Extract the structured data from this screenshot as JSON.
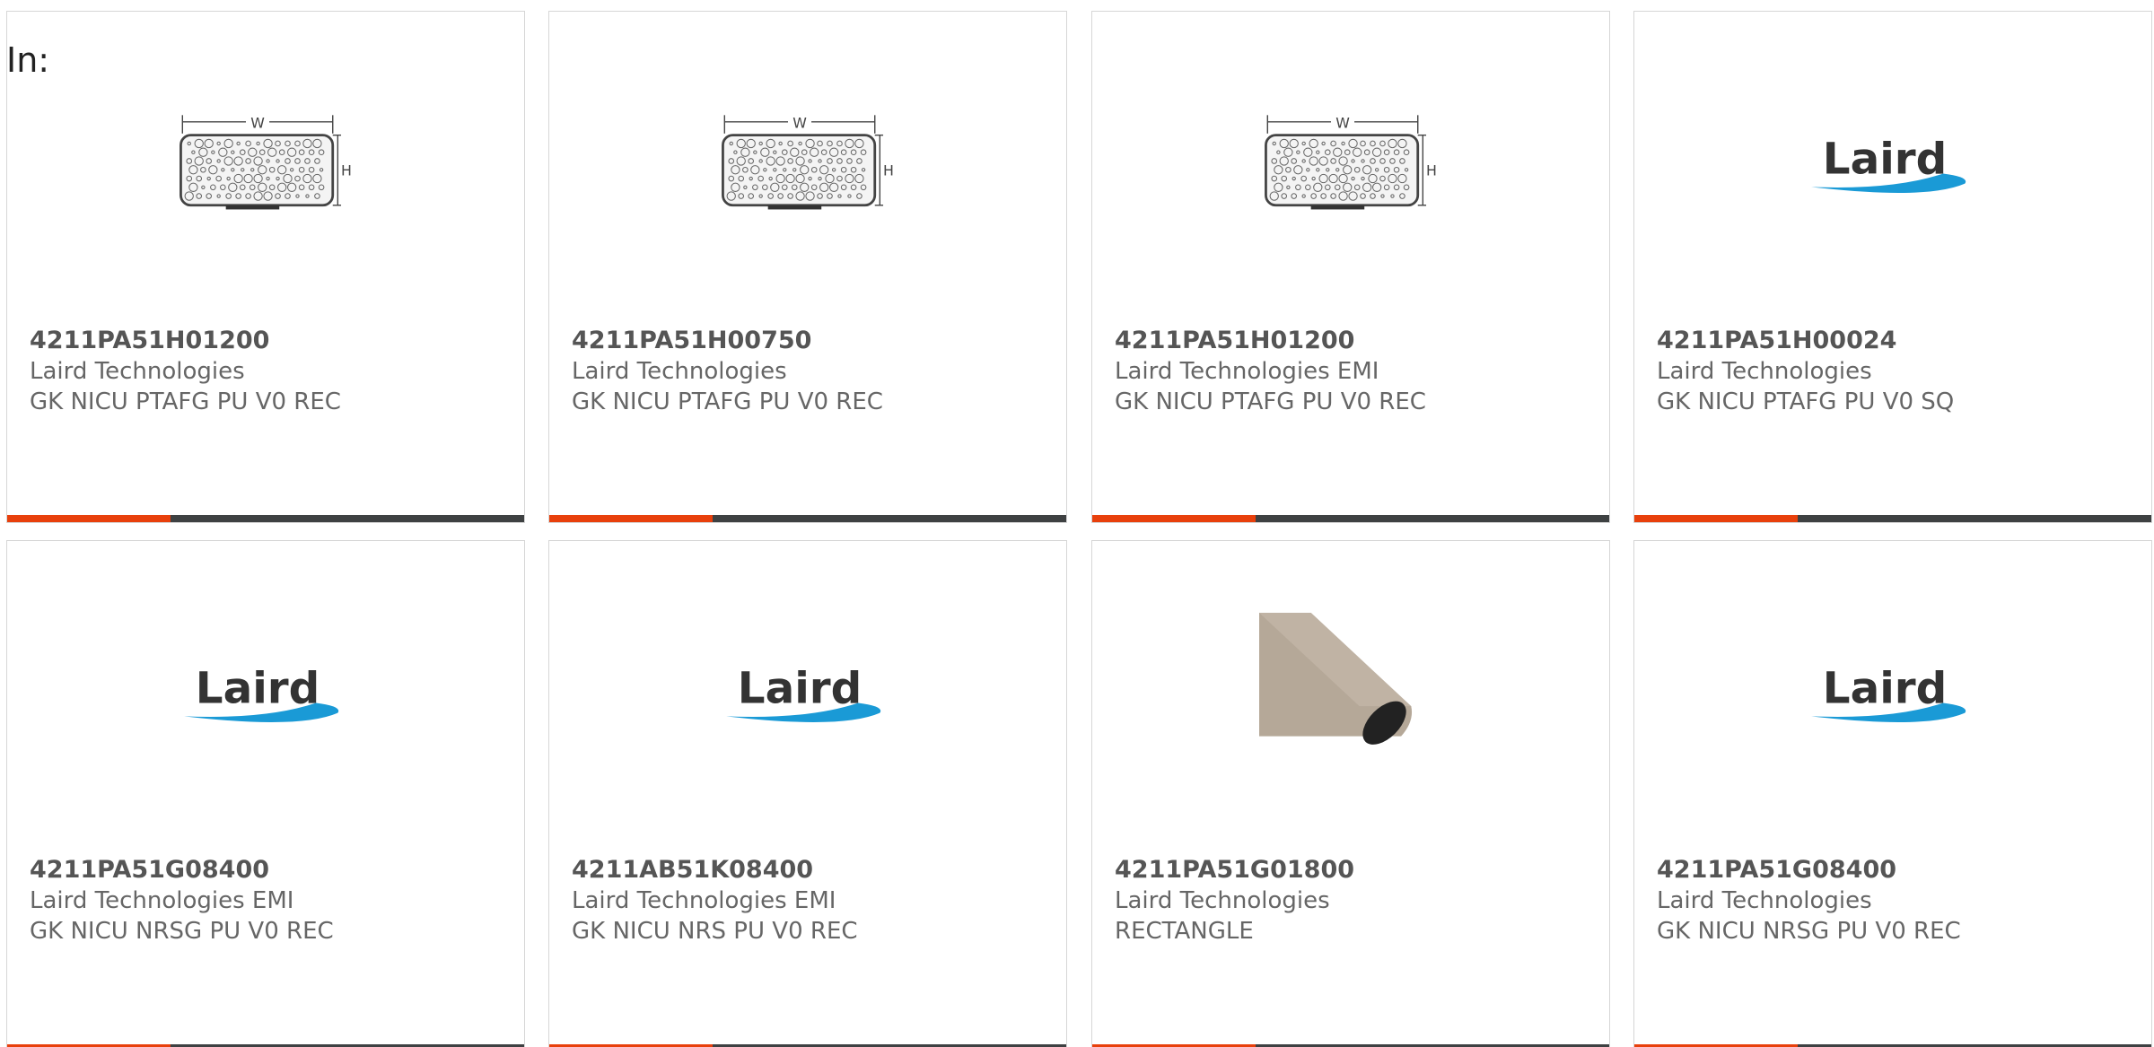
{
  "header": {
    "in_label": "In:"
  },
  "colors": {
    "accent_bar": "#e8400c",
    "dark_bar": "#3e4142",
    "laird_blue": "#1a9ad6",
    "text_bold": "#555555",
    "text_regular": "#666666"
  },
  "products": [
    {
      "part_number": "4211PA51H01200",
      "manufacturer": "Laird Technologies",
      "description": "GK NICU PTAFG PU V0 REC",
      "image": "gasket-dimension-drawing"
    },
    {
      "part_number": "4211PA51H00750",
      "manufacturer": "Laird Technologies",
      "description": "GK NICU PTAFG PU V0 REC",
      "image": "gasket-dimension-drawing"
    },
    {
      "part_number": "4211PA51H01200",
      "manufacturer": "Laird Technologies EMI",
      "description": "GK NICU PTAFG PU V0 REC",
      "image": "gasket-dimension-drawing"
    },
    {
      "part_number": "4211PA51H00024",
      "manufacturer": "Laird Technologies",
      "description": "GK NICU PTAFG PU V0 SQ",
      "image": "laird-logo"
    },
    {
      "part_number": "4211PA51G08400",
      "manufacturer": "Laird Technologies EMI",
      "description": "GK NICU NRSG PU V0 REC",
      "image": "laird-logo"
    },
    {
      "part_number": "4211AB51K08400",
      "manufacturer": "Laird Technologies EMI",
      "description": "GK NICU NRS PU V0 REC",
      "image": "laird-logo"
    },
    {
      "part_number": "4211PA51G01800",
      "manufacturer": "Laird Technologies",
      "description": "RECTANGLE",
      "image": "gasket-photo"
    },
    {
      "part_number": "4211PA51G08400",
      "manufacturer": "Laird Technologies",
      "description": "GK NICU NRSG PU V0 REC",
      "image": "laird-logo"
    }
  ],
  "drawing_labels": {
    "width": "W",
    "height": "H"
  },
  "logo_text": "Laird"
}
